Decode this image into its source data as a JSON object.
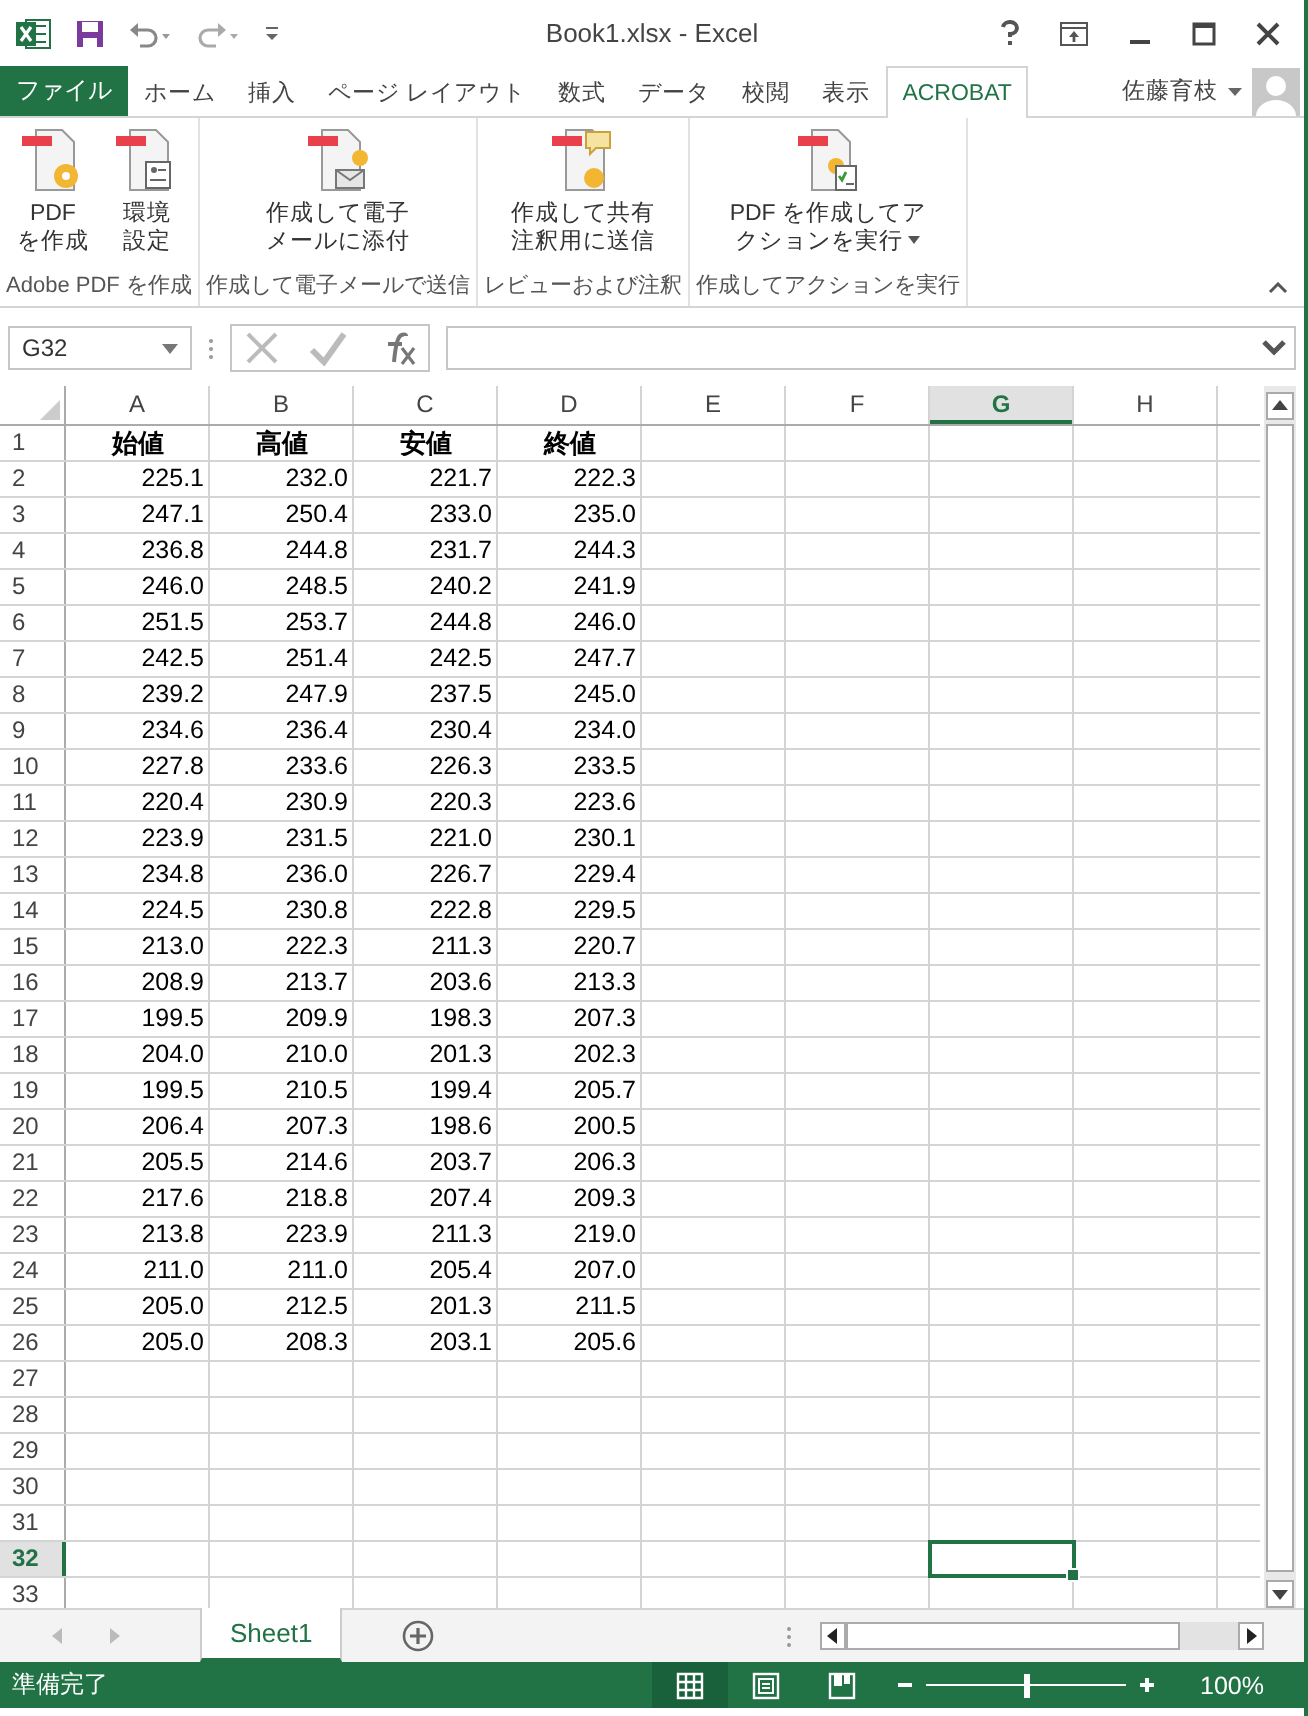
{
  "window": {
    "title": "Book1.xlsx - Excel"
  },
  "tabs": [
    {
      "label": "ファイル",
      "kind": "file",
      "selected": false
    },
    {
      "label": "ホーム",
      "kind": "tab",
      "selected": false
    },
    {
      "label": "挿入",
      "kind": "tab",
      "selected": false
    },
    {
      "label": "ページ レイアウト",
      "kind": "tab",
      "selected": false
    },
    {
      "label": "数式",
      "kind": "tab",
      "selected": false
    },
    {
      "label": "データ",
      "kind": "tab",
      "selected": false
    },
    {
      "label": "校閲",
      "kind": "tab",
      "selected": false
    },
    {
      "label": "表示",
      "kind": "tab",
      "selected": false
    },
    {
      "label": "ACROBAT",
      "kind": "tab",
      "selected": true
    }
  ],
  "user": {
    "name": "佐藤育枝"
  },
  "ribbon": {
    "groups": [
      {
        "label": "Adobe PDF を作成",
        "buttons": [
          {
            "lines": [
              "PDF",
              "を作成"
            ],
            "dropdown": false
          },
          {
            "lines": [
              "環境",
              "設定"
            ],
            "dropdown": false
          }
        ]
      },
      {
        "label": "作成して電子メールで送信",
        "buttons": [
          {
            "lines": [
              "作成して電子",
              "メールに添付"
            ],
            "dropdown": false
          }
        ]
      },
      {
        "label": "レビューおよび注釈",
        "buttons": [
          {
            "lines": [
              "作成して共有",
              "注釈用に送信"
            ],
            "dropdown": false
          }
        ]
      },
      {
        "label": "作成してアクションを実行",
        "buttons": [
          {
            "lines": [
              "PDF を作成してア",
              "クションを実行"
            ],
            "dropdown": true
          }
        ]
      }
    ]
  },
  "name_box": {
    "value": "G32"
  },
  "columns": [
    {
      "label": "A",
      "selected": false
    },
    {
      "label": "B",
      "selected": false
    },
    {
      "label": "C",
      "selected": false
    },
    {
      "label": "D",
      "selected": false
    },
    {
      "label": "E",
      "selected": false
    },
    {
      "label": "F",
      "selected": false
    },
    {
      "label": "G",
      "selected": true
    },
    {
      "label": "H",
      "selected": false
    }
  ],
  "rows": [
    {
      "number": "1",
      "selected": false,
      "kind": "header",
      "cells": [
        "始値",
        "高値",
        "安値",
        "終値"
      ]
    },
    {
      "number": "2",
      "selected": false,
      "kind": "data",
      "cells": [
        "225.1",
        "232.0",
        "221.7",
        "222.3"
      ]
    },
    {
      "number": "3",
      "selected": false,
      "kind": "data",
      "cells": [
        "247.1",
        "250.4",
        "233.0",
        "235.0"
      ]
    },
    {
      "number": "4",
      "selected": false,
      "kind": "data",
      "cells": [
        "236.8",
        "244.8",
        "231.7",
        "244.3"
      ]
    },
    {
      "number": "5",
      "selected": false,
      "kind": "data",
      "cells": [
        "246.0",
        "248.5",
        "240.2",
        "241.9"
      ]
    },
    {
      "number": "6",
      "selected": false,
      "kind": "data",
      "cells": [
        "251.5",
        "253.7",
        "244.8",
        "246.0"
      ]
    },
    {
      "number": "7",
      "selected": false,
      "kind": "data",
      "cells": [
        "242.5",
        "251.4",
        "242.5",
        "247.7"
      ]
    },
    {
      "number": "8",
      "selected": false,
      "kind": "data",
      "cells": [
        "239.2",
        "247.9",
        "237.5",
        "245.0"
      ]
    },
    {
      "number": "9",
      "selected": false,
      "kind": "data",
      "cells": [
        "234.6",
        "236.4",
        "230.4",
        "234.0"
      ]
    },
    {
      "number": "10",
      "selected": false,
      "kind": "data",
      "cells": [
        "227.8",
        "233.6",
        "226.3",
        "233.5"
      ]
    },
    {
      "number": "11",
      "selected": false,
      "kind": "data",
      "cells": [
        "220.4",
        "230.9",
        "220.3",
        "223.6"
      ]
    },
    {
      "number": "12",
      "selected": false,
      "kind": "data",
      "cells": [
        "223.9",
        "231.5",
        "221.0",
        "230.1"
      ]
    },
    {
      "number": "13",
      "selected": false,
      "kind": "data",
      "cells": [
        "234.8",
        "236.0",
        "226.7",
        "229.4"
      ]
    },
    {
      "number": "14",
      "selected": false,
      "kind": "data",
      "cells": [
        "224.5",
        "230.8",
        "222.8",
        "229.5"
      ]
    },
    {
      "number": "15",
      "selected": false,
      "kind": "data",
      "cells": [
        "213.0",
        "222.3",
        "211.3",
        "220.7"
      ]
    },
    {
      "number": "16",
      "selected": false,
      "kind": "data",
      "cells": [
        "208.9",
        "213.7",
        "203.6",
        "213.3"
      ]
    },
    {
      "number": "17",
      "selected": false,
      "kind": "data",
      "cells": [
        "199.5",
        "209.9",
        "198.3",
        "207.3"
      ]
    },
    {
      "number": "18",
      "selected": false,
      "kind": "data",
      "cells": [
        "204.0",
        "210.0",
        "201.3",
        "202.3"
      ]
    },
    {
      "number": "19",
      "selected": false,
      "kind": "data",
      "cells": [
        "199.5",
        "210.5",
        "199.4",
        "205.7"
      ]
    },
    {
      "number": "20",
      "selected": false,
      "kind": "data",
      "cells": [
        "206.4",
        "207.3",
        "198.6",
        "200.5"
      ]
    },
    {
      "number": "21",
      "selected": false,
      "kind": "data",
      "cells": [
        "205.5",
        "214.6",
        "203.7",
        "206.3"
      ]
    },
    {
      "number": "22",
      "selected": false,
      "kind": "data",
      "cells": [
        "217.6",
        "218.8",
        "207.4",
        "209.3"
      ]
    },
    {
      "number": "23",
      "selected": false,
      "kind": "data",
      "cells": [
        "213.8",
        "223.9",
        "211.3",
        "219.0"
      ]
    },
    {
      "number": "24",
      "selected": false,
      "kind": "data",
      "cells": [
        "211.0",
        "211.0",
        "205.4",
        "207.0"
      ]
    },
    {
      "number": "25",
      "selected": false,
      "kind": "data",
      "cells": [
        "205.0",
        "212.5",
        "201.3",
        "211.5"
      ]
    },
    {
      "number": "26",
      "selected": false,
      "kind": "data",
      "cells": [
        "205.0",
        "208.3",
        "203.1",
        "205.6"
      ]
    },
    {
      "number": "27",
      "selected": false,
      "kind": "data"
    },
    {
      "number": "28",
      "selected": false,
      "kind": "data"
    },
    {
      "number": "29",
      "selected": false,
      "kind": "data"
    },
    {
      "number": "30",
      "selected": false,
      "kind": "data"
    },
    {
      "number": "31",
      "selected": false,
      "kind": "data"
    },
    {
      "number": "32",
      "selected": true,
      "kind": "data"
    },
    {
      "number": "33",
      "selected": false,
      "kind": "data"
    }
  ],
  "sheet_tabs": [
    {
      "label": "Sheet1",
      "selected": true
    }
  ],
  "status_bar": {
    "text": "準備完了",
    "views": [
      {
        "selected": true
      },
      {
        "selected": false
      },
      {
        "selected": false
      }
    ],
    "zoom": {
      "level": 0.5,
      "reading": "100%"
    }
  }
}
